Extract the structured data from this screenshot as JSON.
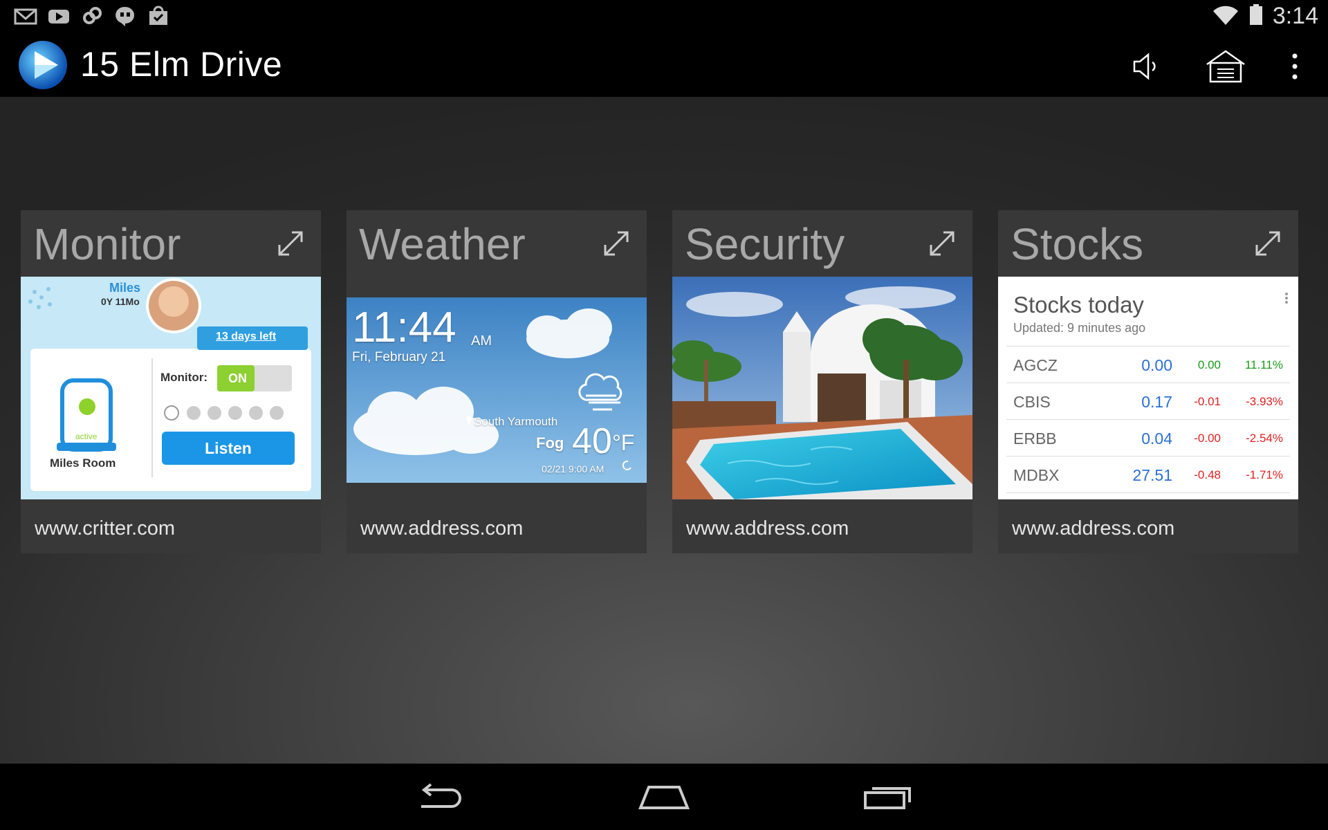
{
  "status_bar": {
    "time": "3:14",
    "notification_icons": [
      "gmail-icon",
      "youtube-icon",
      "link-icon",
      "hangouts-icon",
      "shopping-bag-icon"
    ],
    "system_icons": [
      "wifi-icon",
      "battery-icon"
    ]
  },
  "action_bar": {
    "title": "15 Elm Drive",
    "actions": [
      "speaker-icon",
      "home-icon",
      "overflow-menu-icon"
    ]
  },
  "cards": [
    {
      "title": "Monitor",
      "url": "www.critter.com",
      "widget": {
        "child_name": "Miles",
        "child_age": "0Y 11Mo",
        "days_left": "13 days left",
        "device_status": "active",
        "room_name": "Miles Room",
        "monitor_label": "Monitor:",
        "toggle_state": "ON",
        "listen_label": "Listen"
      }
    },
    {
      "title": "Weather",
      "url": "www.address.com",
      "widget": {
        "time": "11:44",
        "ampm": "AM",
        "date": "Fri, February 21",
        "location": "South Yarmouth",
        "condition": "Fog",
        "temperature": "40",
        "unit": "°F",
        "updated": "02/21 9:00 AM"
      }
    },
    {
      "title": "Security",
      "url": "www.address.com"
    },
    {
      "title": "Stocks",
      "url": "www.address.com",
      "widget": {
        "heading": "Stocks today",
        "updated": "Updated: 9 minutes ago",
        "rows": [
          {
            "symbol": "AGCZ",
            "price": "0.00",
            "change": "0.00",
            "percent": "11.11%",
            "direction": "up"
          },
          {
            "symbol": "CBIS",
            "price": "0.17",
            "change": "-0.01",
            "percent": "-3.93%",
            "direction": "down"
          },
          {
            "symbol": "ERBB",
            "price": "0.04",
            "change": "-0.00",
            "percent": "-2.54%",
            "direction": "down"
          },
          {
            "symbol": "MDBX",
            "price": "27.51",
            "change": "-0.48",
            "percent": "-1.71%",
            "direction": "down"
          }
        ]
      }
    }
  ],
  "nav_bar": [
    "back-icon",
    "home-icon",
    "recent-apps-icon"
  ],
  "colors": {
    "up": "#1a9a1a",
    "down": "#e02020",
    "price": "#2a6fd6",
    "card_bg": "#383838",
    "title_gray": "#a8a8a8"
  }
}
